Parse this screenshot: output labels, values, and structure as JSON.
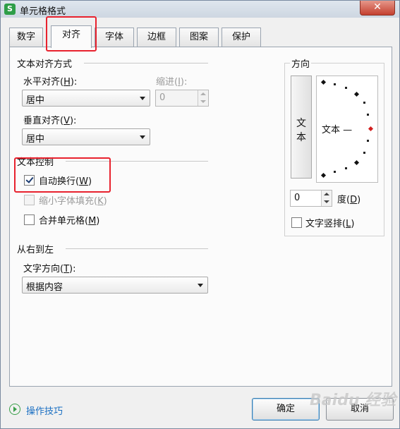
{
  "window": {
    "title": "单元格格式",
    "app_icon": "S",
    "close_label": "✕"
  },
  "tabs": [
    {
      "label": "数字"
    },
    {
      "label": "对齐"
    },
    {
      "label": "字体"
    },
    {
      "label": "边框"
    },
    {
      "label": "图案"
    },
    {
      "label": "保护"
    }
  ],
  "active_tab": "对齐",
  "text_align": {
    "group_title": "文本对齐方式",
    "horizontal_label": "水平对齐(",
    "horizontal_key": "H",
    "horizontal_tail": "):",
    "horizontal_value": "居中",
    "indent_label": "缩进(",
    "indent_key": "I",
    "indent_tail": "):",
    "indent_value": "0",
    "vertical_label": "垂直对齐(",
    "vertical_key": "V",
    "vertical_tail": "):",
    "vertical_value": "居中"
  },
  "text_control": {
    "group_title": "文本控制",
    "wrap_label": "自动换行(",
    "wrap_key": "W",
    "wrap_tail": ")",
    "wrap_checked": true,
    "shrink_label": "缩小字体填充(",
    "shrink_key": "K",
    "shrink_tail": ")",
    "shrink_checked": false,
    "merge_label": "合并单元格(",
    "merge_key": "M",
    "merge_tail": ")",
    "merge_checked": false
  },
  "rtl": {
    "group_title": "从右到左",
    "direction_label": "文字方向(",
    "direction_key": "T",
    "direction_tail": "):",
    "direction_value": "根据内容"
  },
  "orientation": {
    "group_title": "方向",
    "vertical_chars": [
      "文",
      "本"
    ],
    "dial_text": "文本 —",
    "degree_value": "0",
    "degree_label": "度(",
    "degree_key": "D",
    "degree_tail": ")",
    "vertical_text_label": "文字竖排(",
    "vertical_text_key": "L",
    "vertical_text_tail": ")"
  },
  "footer": {
    "tips_label": "操作技巧",
    "ok_label": "确定",
    "cancel_label": "取消"
  },
  "watermark": "Baidu 经验",
  "colors": {
    "highlight": "#e8222e",
    "link": "#1a6fc2",
    "app_icon": "#2e9e48"
  }
}
